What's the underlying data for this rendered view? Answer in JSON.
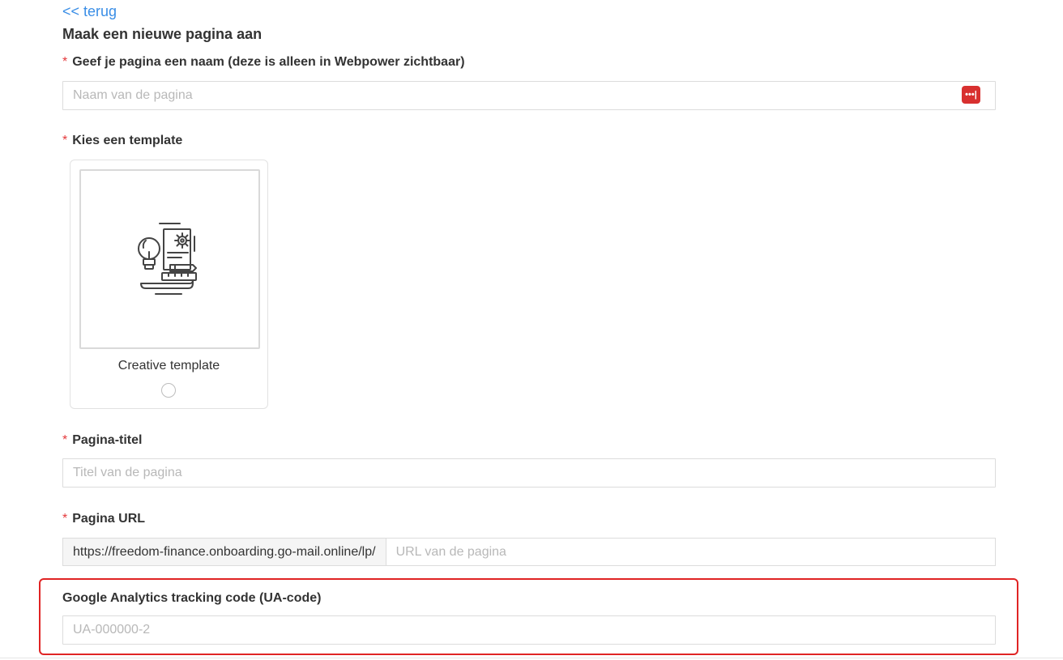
{
  "nav": {
    "back_label": "<< terug"
  },
  "page": {
    "heading": "Maak een nieuwe pagina aan"
  },
  "form": {
    "required_marker": "*",
    "name_field": {
      "label": "Geef je pagina een naam (deze is alleen in Webpower zichtbaar)",
      "placeholder": "Naam van de pagina",
      "value": "",
      "extension_icon": "password-manager-icon",
      "extension_text": "•••|"
    },
    "template_field": {
      "label": "Kies een template",
      "templates": [
        {
          "name": "Creative template",
          "icon": "creative-idea-illustration-icon",
          "selected": false
        }
      ]
    },
    "title_field": {
      "label": "Pagina-titel",
      "placeholder": "Titel van de pagina",
      "value": ""
    },
    "url_field": {
      "label": "Pagina URL",
      "prefix": "https://freedom-finance.onboarding.go-mail.online/lp/",
      "placeholder": "URL van de pagina",
      "value": ""
    },
    "analytics_field": {
      "label": "Google Analytics tracking code (UA-code)",
      "placeholder": "UA-000000-2",
      "value": ""
    }
  },
  "colors": {
    "link": "#3a8ee6",
    "required": "#e4393c",
    "highlight": "#e02424",
    "extension_badge": "#d8302f"
  }
}
